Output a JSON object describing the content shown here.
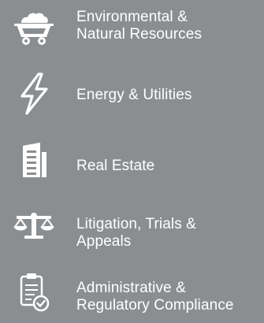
{
  "practice_areas": [
    {
      "label": "Environmental &\nNatural Resources",
      "icon": "mine-cart-icon"
    },
    {
      "label": "Energy & Utilities",
      "icon": "lightning-bolt-icon"
    },
    {
      "label": "Real Estate",
      "icon": "building-icon"
    },
    {
      "label": "Litigation, Trials &\nAppeals",
      "icon": "scales-of-justice-icon"
    },
    {
      "label": "Administrative &\nRegulatory Compliance",
      "icon": "clipboard-check-icon"
    }
  ],
  "colors": {
    "background": "#8b8e91",
    "text": "#ffffff",
    "icon": "#ffffff"
  }
}
